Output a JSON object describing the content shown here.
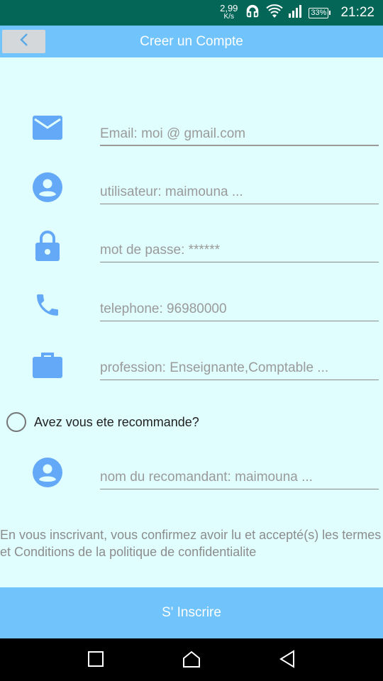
{
  "status_bar": {
    "net_speed": "2,99",
    "net_speed_unit": "K/s",
    "battery": "33%",
    "time": "21:22",
    "color": "#036657"
  },
  "app_bar": {
    "title": "Creer un Compte",
    "color": "#70c3fb"
  },
  "form": {
    "fields": [
      {
        "icon": "mail-icon",
        "placeholder": "Email: moi @ gmail.com"
      },
      {
        "icon": "account-circle-icon",
        "placeholder": "utilisateur: maimouna ..."
      },
      {
        "icon": "lock-icon",
        "placeholder": "mot de passe: ******"
      },
      {
        "icon": "phone-icon",
        "placeholder": "telephone: 96980000"
      },
      {
        "icon": "briefcase-icon",
        "placeholder": "profession: Enseignante,Comptable ..."
      }
    ],
    "recommended_label": "Avez vous ete recommande?",
    "recommender": {
      "icon": "account-circle-icon",
      "placeholder": "nom du recomandant: maimouna ..."
    },
    "icon_color": "#64a9f7"
  },
  "terms_text": "En vous inscrivant, vous confirmez avoir lu et accepté(s) les termes et Conditions de la politique de confidentialite",
  "submit_label": "S' Inscrire"
}
